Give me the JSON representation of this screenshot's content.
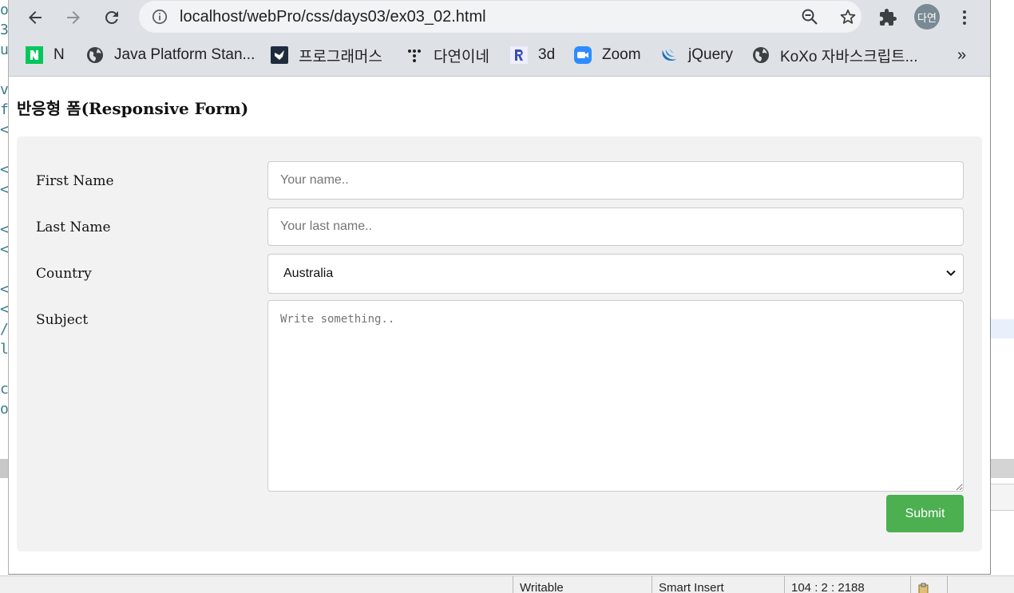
{
  "browser": {
    "url": "localhost/webPro/css/days03/ex03_02.html",
    "profile_label": "다연",
    "bookmarks": [
      {
        "label": "N"
      },
      {
        "label": "Java Platform Stan..."
      },
      {
        "label": "프로그래머스"
      },
      {
        "label": "다연이네"
      },
      {
        "label": "3d"
      },
      {
        "label": "Zoom"
      },
      {
        "label": "jQuery"
      },
      {
        "label": "KoXo 자바스크립트..."
      }
    ],
    "overflow_label": "»"
  },
  "page": {
    "title": "반응형 폼(Responsive Form)",
    "form": {
      "first_name_label": "First Name",
      "first_name_placeholder": "Your name..",
      "last_name_label": "Last Name",
      "last_name_placeholder": "Your last name..",
      "country_label": "Country",
      "country_value": "Australia",
      "subject_label": "Subject",
      "subject_placeholder": "Write something..",
      "submit_label": "Submit"
    }
  },
  "status_bar": {
    "mode": "Writable",
    "insert": "Smart Insert",
    "position": "104 : 2 : 2188"
  },
  "colors": {
    "submit": "#4caf50",
    "panel": "#f2f2f2",
    "toolbar": "#dee1e6"
  }
}
